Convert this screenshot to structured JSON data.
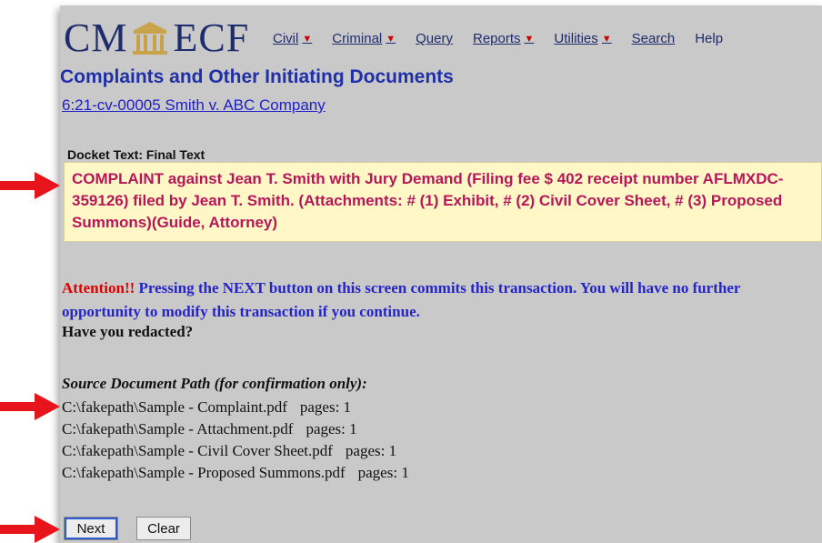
{
  "app": {
    "logo_left": "CM",
    "logo_right": "ECF"
  },
  "menu": [
    {
      "label": "Civil",
      "has_caret": true
    },
    {
      "label": "Criminal",
      "has_caret": true
    },
    {
      "label": "Query",
      "has_caret": false
    },
    {
      "label": "Reports",
      "has_caret": true
    },
    {
      "label": "Utilities",
      "has_caret": true
    },
    {
      "label": "Search",
      "has_caret": false
    },
    {
      "label": "Help",
      "has_caret": false
    }
  ],
  "page": {
    "title": "Complaints and Other Initiating Documents",
    "case_link": "6:21-cv-00005 Smith v. ABC Company"
  },
  "docket": {
    "label": "Docket Text: Final Text",
    "text": "COMPLAINT against Jean T. Smith with Jury Demand (Filing fee $ 402 receipt number AFLMXDC-359126) filed by Jean T. Smith. (Attachments: # (1) Exhibit, # (2) Civil Cover Sheet, # (3) Proposed Summons)(Guide, Attorney)"
  },
  "attention": {
    "word": "Attention!!",
    "message": " Pressing the NEXT button on this screen commits this transaction. You will have no further opportunity to modify this transaction if you continue.",
    "redacted_question": "Have you redacted?"
  },
  "source": {
    "heading": "Source Document Path (for confirmation only):",
    "files": [
      {
        "path": "C:\\fakepath\\Sample - Complaint.pdf",
        "pages": "pages: 1"
      },
      {
        "path": "C:\\fakepath\\Sample - Attachment.pdf",
        "pages": "pages: 1"
      },
      {
        "path": "C:\\fakepath\\Sample - Civil Cover Sheet.pdf",
        "pages": "pages: 1"
      },
      {
        "path": "C:\\fakepath\\Sample - Proposed Summons.pdf",
        "pages": "pages: 1"
      }
    ]
  },
  "buttons": {
    "next": "Next",
    "clear": "Clear"
  },
  "colors": {
    "arrow": "#e8141c",
    "docket_bg": "#fff8c6",
    "docket_text": "#b8165a",
    "title": "#2030a8"
  }
}
